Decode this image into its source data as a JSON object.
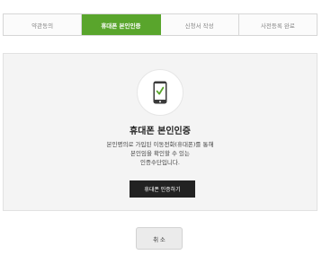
{
  "steps": [
    {
      "label": "약관동의",
      "active": false
    },
    {
      "label": "휴대폰 본인인증",
      "active": true
    },
    {
      "label": "신청서 작성",
      "active": false
    },
    {
      "label": "사전등록 완료",
      "active": false
    }
  ],
  "panel": {
    "icon": "mobile-phone-check-icon",
    "title": "휴대폰 본인인증",
    "desc_lines": [
      "본인명의로 가입된 이동전화(휴대폰)를 통해",
      "본인임을 확인할 수 있는",
      "인증수단입니다."
    ],
    "verify_button": "휴대폰 인증하기"
  },
  "cancel_button": "취 소",
  "colors": {
    "accent": "#59a52c",
    "dark_button": "#222222",
    "panel_bg": "#f4f4f4"
  }
}
